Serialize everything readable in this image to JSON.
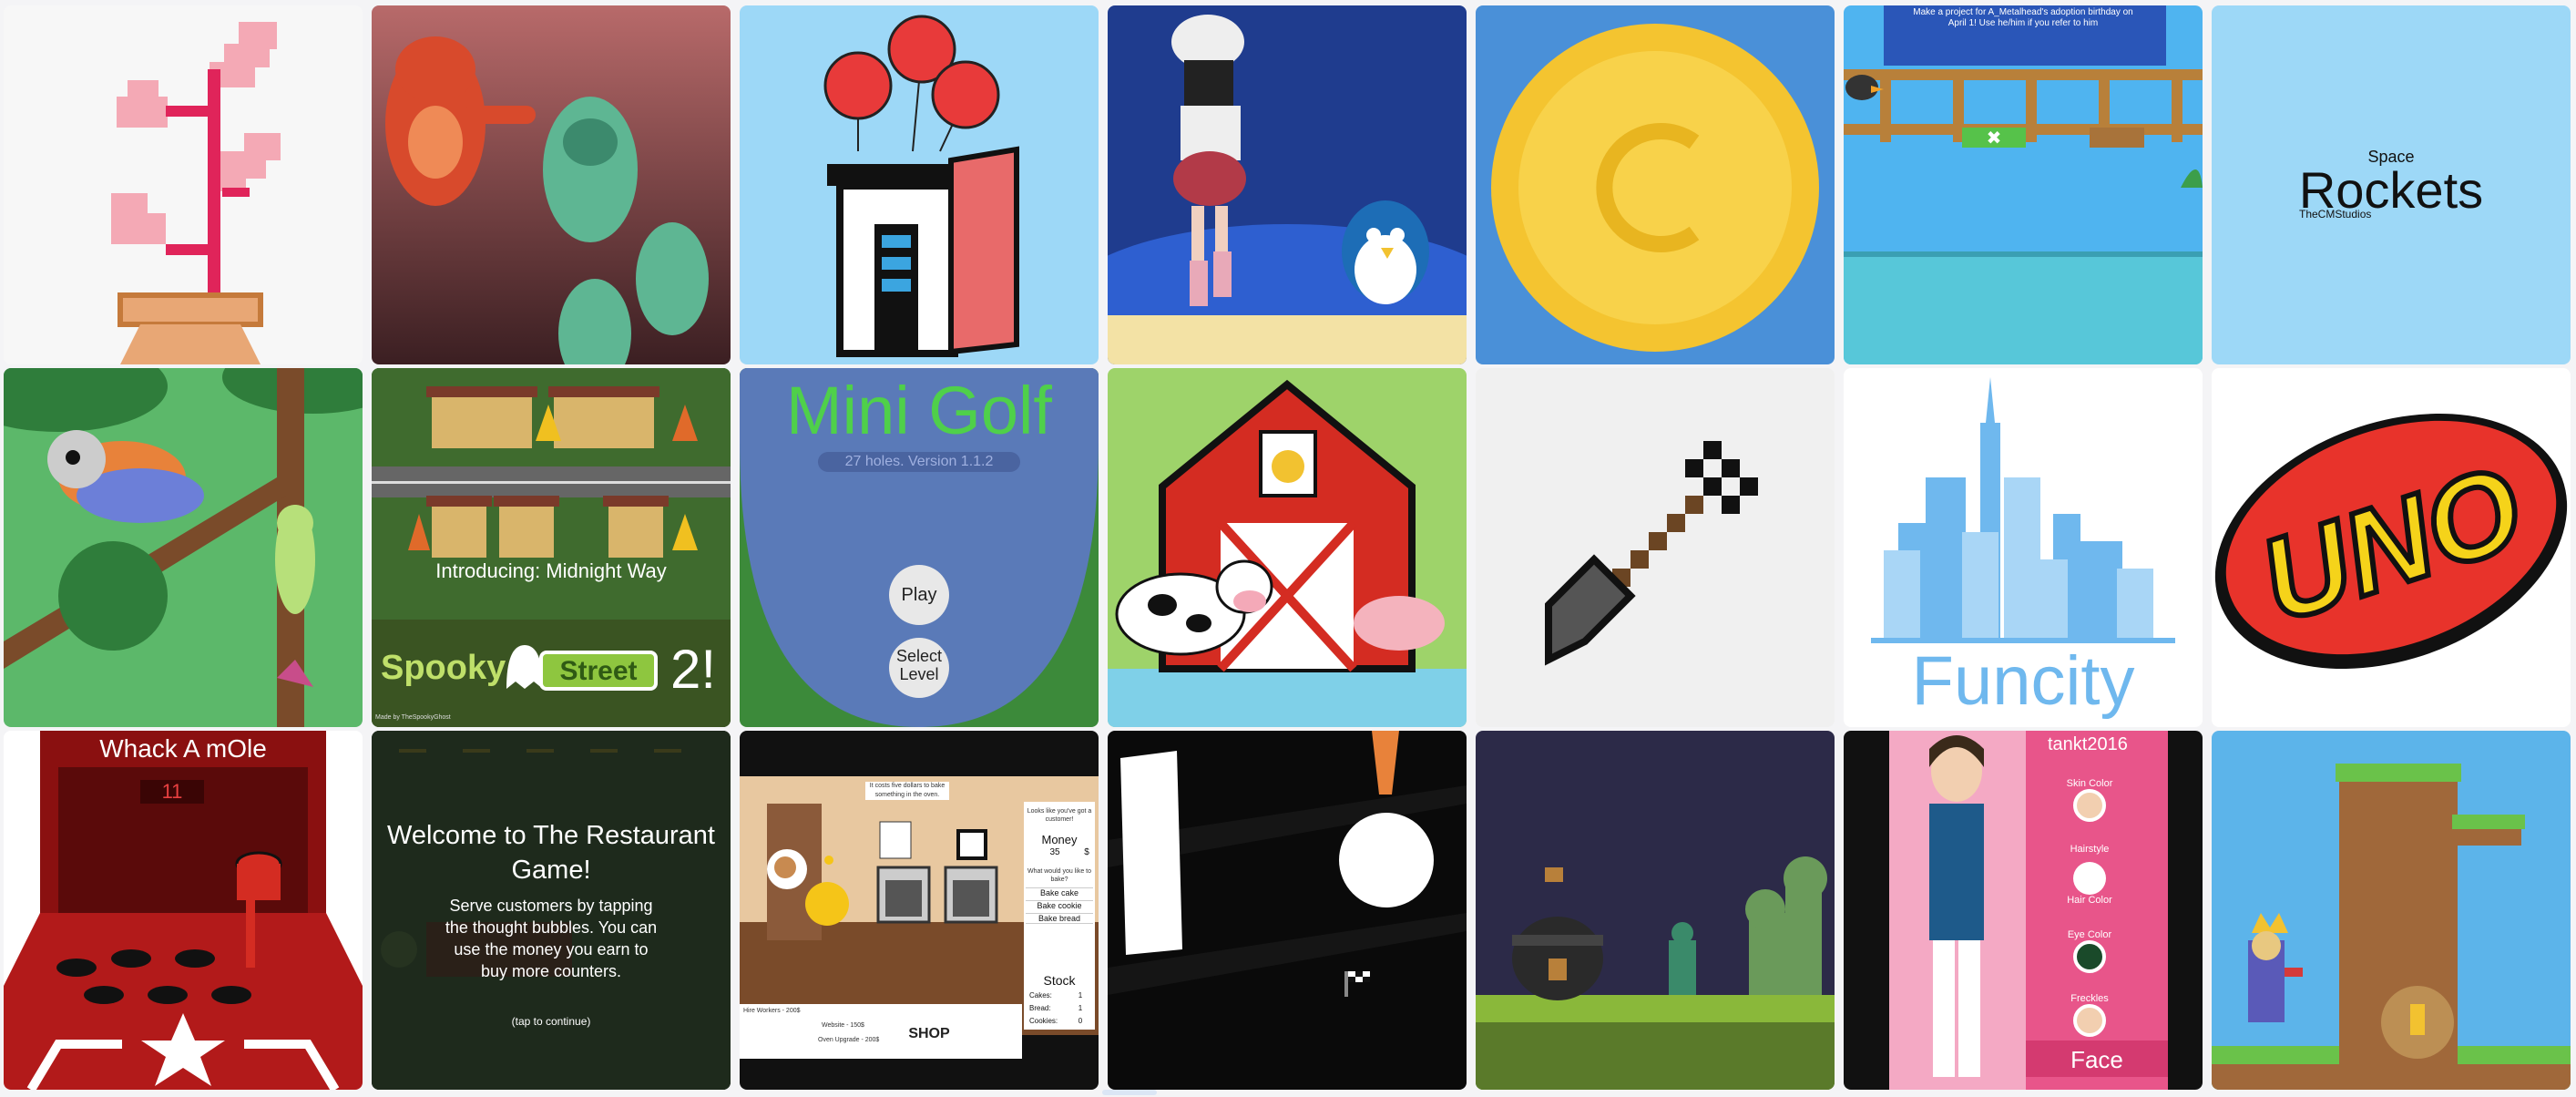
{
  "projects": {
    "space_rockets": {
      "title_small": "Space",
      "title_big": "Rockets",
      "studio": "TheCMStudios"
    },
    "adoption": {
      "banner": "Make a project for A_Metalhead's adoption birthday on April 1! Use he/him if you refer to him"
    },
    "spooky": {
      "intro": "Introducing: Midnight Way",
      "spooky": "Spooky",
      "street": "Street",
      "num": "2!",
      "credit": "Made by TheSpookyGhost"
    },
    "golf": {
      "title": "Mini Golf",
      "subtitle": "27 holes. Version 1.1.2",
      "play": "Play",
      "select": "Select Level"
    },
    "funcity": {
      "title": "Funcity"
    },
    "uno": {
      "title": "UNO"
    },
    "whack": {
      "title": "Whack A mOle",
      "score": "11"
    },
    "restaurant": {
      "title": "Welcome to The Restaurant Game!",
      "body": "Serve customers by tapping the thought bubbles. You can use the money you earn to buy more counters.",
      "tap": "(tap to continue)"
    },
    "bakery": {
      "hint": "It costs five dollars to bake something in the oven.",
      "customer": "Looks like you've got a customer!",
      "money_label": "Money",
      "money": "35",
      "money_unit": "$",
      "question": "What would you like to bake?",
      "bake1": "Bake cake",
      "bake2": "Bake cookie",
      "bake3": "Bake bread",
      "stock": "Stock",
      "cakes_label": "Cakes:",
      "cakes": "1",
      "bread_label": "Bread:",
      "bread": "1",
      "cookies_label": "Cookies:",
      "cookies": "0",
      "hire": "Hire Workers - 200$",
      "website": "Website - 150$",
      "oven": "Oven Upgrade - 200$",
      "shop": "SHOP"
    },
    "avatar": {
      "user": "tankt2016",
      "skin": "Skin Color",
      "hairstyle": "Hairstyle",
      "hair": "Hair Color",
      "eye": "Eye Color",
      "freckles": "Freckles",
      "face": "Face"
    }
  },
  "colors": {
    "sky": "#9dd8f7",
    "uno_red": "#e8332b",
    "uno_yellow": "#f5d31a",
    "funcity_blue": "#6fb8ee"
  }
}
